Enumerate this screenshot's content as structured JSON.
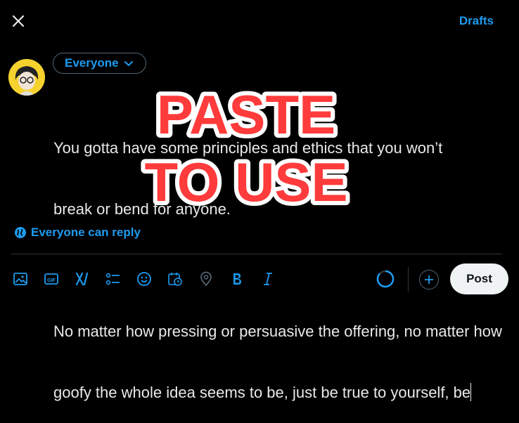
{
  "header": {
    "close_icon": "close-icon",
    "drafts_label": "Drafts"
  },
  "composer": {
    "audience_label": "Everyone",
    "text_line1": "You gotta have some principles and ethics that you won’t",
    "text_line2": "break or bend for anyone.",
    "text_line3": "No matter how pressing or persuasive the offering, no matter how",
    "text_line4": "goofy the whole idea seems to be, just be true to yourself, be"
  },
  "overlay": {
    "line1": "PASTE",
    "line2": "TO USE",
    "fill_color": "#ff3b3b",
    "stroke_color": "#ffffff"
  },
  "reply": {
    "label": "Everyone can reply"
  },
  "toolbar": {
    "icons": [
      "image-icon",
      "gif-icon",
      "grok-icon",
      "poll-icon",
      "emoji-icon",
      "schedule-icon",
      "location-icon",
      "bold-icon",
      "italic-icon"
    ],
    "post_label": "Post"
  },
  "colors": {
    "accent": "#1d9bf0",
    "background": "#000000",
    "text": "#e7e9ea"
  }
}
